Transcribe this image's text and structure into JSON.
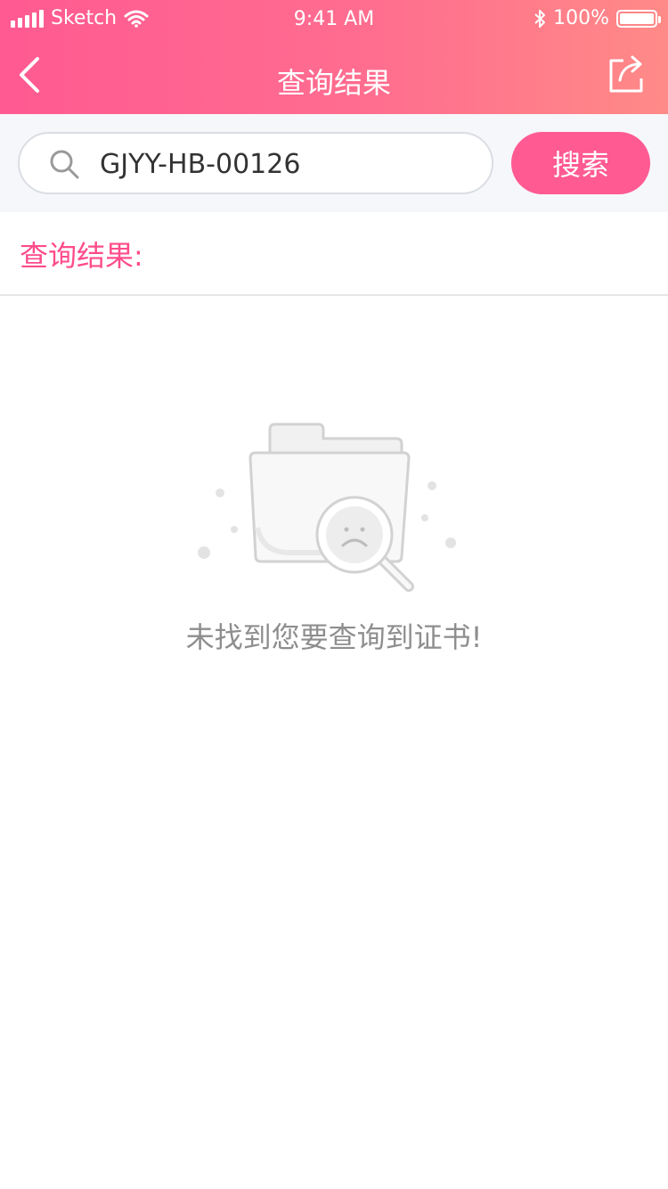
{
  "status_bar": {
    "carrier": "Sketch",
    "time": "9:41 AM",
    "battery": "100%"
  },
  "nav": {
    "title": "查询结果"
  },
  "search": {
    "value": "GJYY-HB-00126",
    "button_label": "搜索"
  },
  "results": {
    "label": "查询结果:"
  },
  "empty_state": {
    "message": "未找到您要查询到证书!"
  },
  "colors": {
    "accent": "#ff5a92",
    "accent_text": "#ff4c8b",
    "muted_text": "#8e8e8e"
  }
}
